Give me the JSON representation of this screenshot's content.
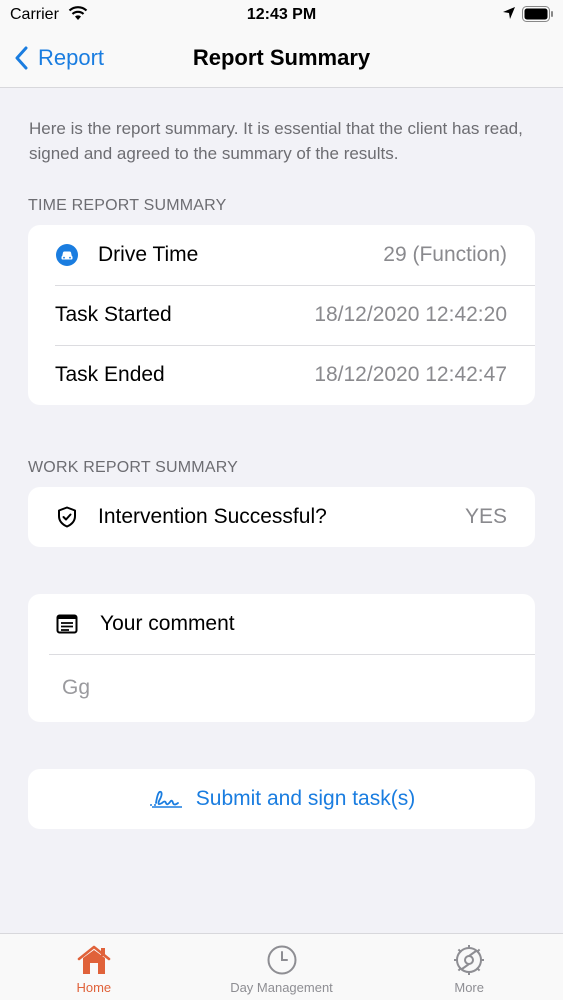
{
  "status": {
    "carrier": "Carrier",
    "time": "12:43 PM"
  },
  "nav": {
    "back_label": "Report",
    "title": "Report Summary"
  },
  "intro": "Here is the report summary. It is essential that the client has read, signed and agreed to the summary of the results.",
  "time_section": {
    "header": "TIME REPORT SUMMARY",
    "rows": [
      {
        "label": "Drive Time",
        "value": "29 (Function)",
        "icon": "car-icon"
      },
      {
        "label": "Task Started",
        "value": "18/12/2020 12:42:20"
      },
      {
        "label": "Task Ended",
        "value": "18/12/2020 12:42:47"
      }
    ]
  },
  "work_section": {
    "header": "WORK REPORT SUMMARY",
    "rows": [
      {
        "label": "Intervention Successful?",
        "value": "YES",
        "icon": "shield-check-icon"
      }
    ]
  },
  "comment": {
    "label": "Your comment",
    "value": "Gg",
    "icon": "note-icon"
  },
  "submit": {
    "label": "Submit and sign task(s)",
    "icon": "signature-icon"
  },
  "tabs": [
    {
      "label": "Home",
      "icon": "house-icon",
      "active": true
    },
    {
      "label": "Day Management",
      "icon": "clock-icon",
      "active": false
    },
    {
      "label": "More",
      "icon": "gear-icon",
      "active": false
    }
  ],
  "colors": {
    "accent": "#1a7de0",
    "tab_active": "#e0623a",
    "background": "#f2f2f7",
    "secondary_text": "#8a8a8e"
  }
}
